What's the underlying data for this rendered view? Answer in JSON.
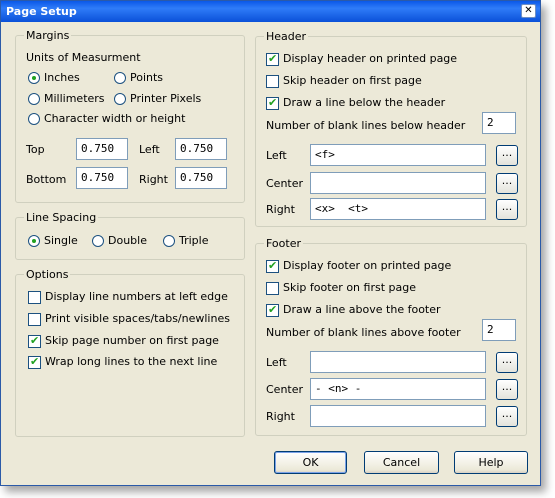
{
  "window": {
    "title": "Page Setup",
    "close_glyph": "✕"
  },
  "margins": {
    "legend": "Margins",
    "units_label": "Units of Measurment",
    "units": [
      {
        "label": "Inches",
        "checked": true
      },
      {
        "label": "Points",
        "checked": false
      },
      {
        "label": "Millimeters",
        "checked": false
      },
      {
        "label": "Printer Pixels",
        "checked": false
      },
      {
        "label": "Character width or height",
        "checked": false
      }
    ],
    "top_label": "Top",
    "top_value": "0.750",
    "left_label": "Left",
    "left_value": "0.750",
    "bottom_label": "Bottom",
    "bottom_value": "0.750",
    "right_label": "Right",
    "right_value": "0.750"
  },
  "line_spacing": {
    "legend": "Line Spacing",
    "options": [
      {
        "label": "Single",
        "checked": true
      },
      {
        "label": "Double",
        "checked": false
      },
      {
        "label": "Triple",
        "checked": false
      }
    ]
  },
  "options": {
    "legend": "Options",
    "items": [
      {
        "label": "Display line numbers at left edge",
        "checked": false
      },
      {
        "label": "Print visible spaces/tabs/newlines",
        "checked": false
      },
      {
        "label": "Skip page number on first page",
        "checked": true
      },
      {
        "label": "Wrap long lines to the next line",
        "checked": true
      }
    ]
  },
  "header": {
    "legend": "Header",
    "checks": [
      {
        "label": "Display header on printed page",
        "checked": true
      },
      {
        "label": "Skip header on first page",
        "checked": false
      },
      {
        "label": "Draw a line below the header",
        "checked": true
      }
    ],
    "blank_lines_label": "Number of blank lines below header",
    "blank_lines_value": "2",
    "left_label": "Left",
    "left_value": "<f>",
    "center_label": "Center",
    "center_value": "",
    "right_label": "Right",
    "right_value": "<x>  <t>",
    "dots": "..."
  },
  "footer": {
    "legend": "Footer",
    "checks": [
      {
        "label": "Display footer on printed page",
        "checked": true
      },
      {
        "label": "Skip footer on first page",
        "checked": false
      },
      {
        "label": "Draw a line above the footer",
        "checked": true
      }
    ],
    "blank_lines_label": "Number of blank lines above footer",
    "blank_lines_value": "2",
    "left_label": "Left",
    "left_value": "",
    "center_label": "Center",
    "center_value": "- <n> -",
    "right_label": "Right",
    "right_value": "",
    "dots": "..."
  },
  "buttons": {
    "ok": "OK",
    "cancel": "Cancel",
    "help": "Help"
  }
}
